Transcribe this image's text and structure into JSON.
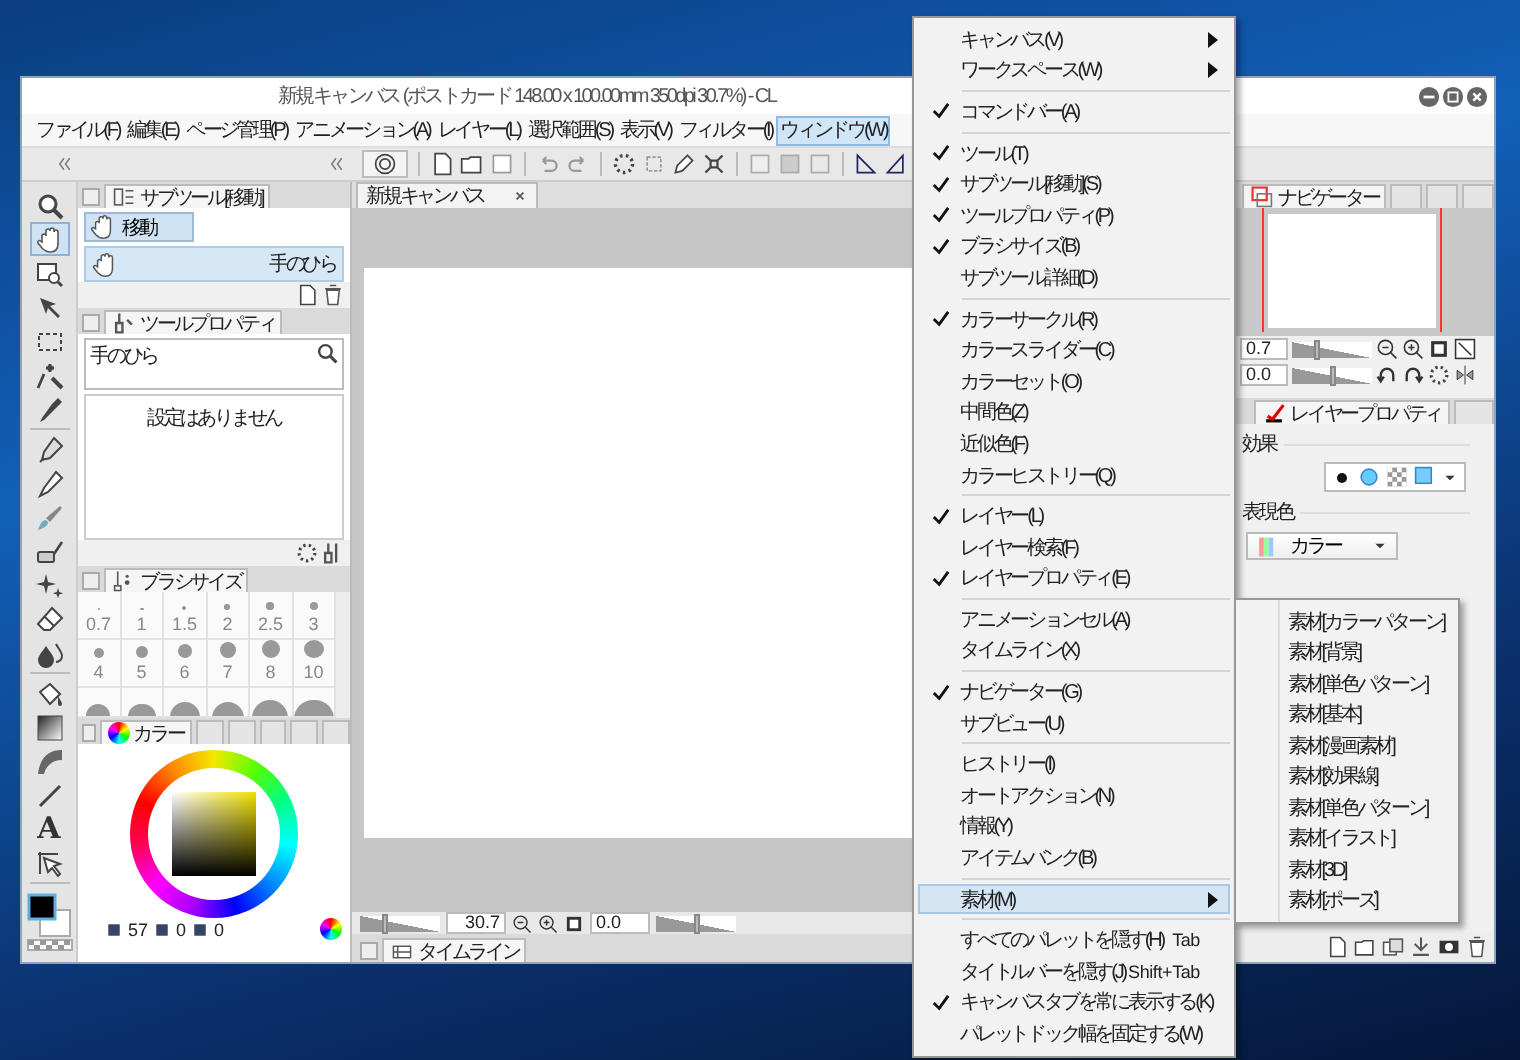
{
  "window": {
    "title": "新規キャンバス (ポストカード 148.00 x 100.00mm 350dpi 30.7%) - CL"
  },
  "menu_bar": [
    {
      "label": "ファイル(F)",
      "selected": false
    },
    {
      "label": "編集(E)",
      "selected": false
    },
    {
      "label": "ページ管理(P)",
      "selected": false
    },
    {
      "label": "アニメーション(A)",
      "selected": false
    },
    {
      "label": "レイヤー(L)",
      "selected": false
    },
    {
      "label": "選択範囲(S)",
      "selected": false
    },
    {
      "label": "表示(V)",
      "selected": false
    },
    {
      "label": "フィルター(I)",
      "selected": false
    },
    {
      "label": "ウィンドウ(W)",
      "selected": true
    }
  ],
  "tool_groups": [
    {
      "tools": [
        {
          "kind": "zoom",
          "selected": false
        },
        {
          "kind": "hand",
          "selected": true
        },
        {
          "kind": "rotate",
          "selected": false
        },
        {
          "kind": "move",
          "selected": false
        },
        {
          "kind": "marquee",
          "selected": false
        },
        {
          "kind": "wand",
          "selected": false
        },
        {
          "kind": "eyedropper",
          "selected": false
        }
      ]
    },
    {
      "tools": [
        {
          "kind": "pen",
          "selected": false
        },
        {
          "kind": "pencil",
          "selected": false
        },
        {
          "kind": "brush",
          "selected": false
        },
        {
          "kind": "airbrush",
          "selected": false
        },
        {
          "kind": "sparkle",
          "selected": false
        },
        {
          "kind": "eraser",
          "selected": false
        },
        {
          "kind": "blend",
          "selected": false
        }
      ]
    },
    {
      "tools": [
        {
          "kind": "fill",
          "selected": false
        },
        {
          "kind": "gradient",
          "selected": false
        },
        {
          "kind": "curve",
          "selected": false
        },
        {
          "kind": "line",
          "selected": false
        },
        {
          "kind": "text",
          "glyph": "A",
          "selected": false
        },
        {
          "kind": "frame",
          "selected": false
        }
      ]
    }
  ],
  "sub_tool": {
    "tab": "サブツール[移動]",
    "group": "移動",
    "items": [
      {
        "label": "手のひら",
        "selected": true
      }
    ]
  },
  "tool_property": {
    "tab": "ツールプロパティ",
    "tool_name": "手のひら",
    "message": "設定はありません"
  },
  "brush_size": {
    "tab": "ブラシサイズ",
    "sizes": [
      "0.7",
      "1",
      "1.5",
      "2",
      "2.5",
      "3",
      "4",
      "5",
      "6",
      "7",
      "8",
      "10"
    ]
  },
  "color": {
    "tab": "カラー",
    "readouts": [
      "57",
      "0",
      "0"
    ]
  },
  "canvas": {
    "tab": "新規キャンバス",
    "zoom": "30.7",
    "zoom_slider": {
      "level": 0.3
    },
    "angle": "0.0",
    "angle_slider": {
      "level": 0.5
    },
    "timeline_tab": "タイムライン"
  },
  "navigator": {
    "tab": "ナビゲーター",
    "zoom": "0.7",
    "zoom_slider": {
      "level": 0.3
    },
    "angle": "0.0",
    "angle_slider": {
      "level": 0.5
    }
  },
  "layer_property": {
    "tab": "レイヤープロパティ",
    "effect_label": "効果",
    "expression_label": "表現色",
    "expression_value": "カラー"
  },
  "window_menu": {
    "groups": [
      {
        "items": [
          {
            "label": "キャンバス(V)",
            "kind": "submenu",
            "checked": false,
            "selected": false
          },
          {
            "label": "ワークスペース(W)",
            "kind": "submenu",
            "checked": false,
            "selected": false
          }
        ]
      },
      {
        "items": [
          {
            "label": "コマンドバー(A)",
            "kind": "item",
            "checked": true,
            "selected": false
          }
        ]
      },
      {
        "items": [
          {
            "label": "ツール(T)",
            "kind": "item",
            "checked": true,
            "selected": false
          },
          {
            "label": "サブツール[移動](S)",
            "kind": "item",
            "checked": true,
            "selected": false
          },
          {
            "label": "ツールプロパティ(P)",
            "kind": "item",
            "checked": true,
            "selected": false
          },
          {
            "label": "ブラシサイズ(B)",
            "kind": "item",
            "checked": true,
            "selected": false
          },
          {
            "label": "サブツール詳細(D)",
            "kind": "item",
            "checked": false,
            "selected": false
          }
        ]
      },
      {
        "items": [
          {
            "label": "カラーサークル(R)",
            "kind": "item",
            "checked": true,
            "selected": false
          },
          {
            "label": "カラースライダー(C)",
            "kind": "item",
            "checked": false,
            "selected": false
          },
          {
            "label": "カラーセット(O)",
            "kind": "item",
            "checked": false,
            "selected": false
          },
          {
            "label": "中間色(Z)",
            "kind": "item",
            "checked": false,
            "selected": false
          },
          {
            "label": "近似色(F)",
            "kind": "item",
            "checked": false,
            "selected": false
          },
          {
            "label": "カラーヒストリー(Q)",
            "kind": "item",
            "checked": false,
            "selected": false
          }
        ]
      },
      {
        "items": [
          {
            "label": "レイヤー(L)",
            "kind": "item",
            "checked": true,
            "selected": false
          },
          {
            "label": "レイヤー検索(F)",
            "kind": "item",
            "checked": false,
            "selected": false
          },
          {
            "label": "レイヤープロパティ(E)",
            "kind": "item",
            "checked": true,
            "selected": false
          }
        ]
      },
      {
        "items": [
          {
            "label": "アニメーションセル(A)",
            "kind": "item",
            "checked": false,
            "selected": false
          },
          {
            "label": "タイムライン(X)",
            "kind": "item",
            "checked": false,
            "selected": false
          }
        ]
      },
      {
        "items": [
          {
            "label": "ナビゲーター(G)",
            "kind": "item",
            "checked": true,
            "selected": false
          },
          {
            "label": "サブビュー(U)",
            "kind": "item",
            "checked": false,
            "selected": false
          }
        ]
      },
      {
        "items": [
          {
            "label": "ヒストリー(I)",
            "kind": "item",
            "checked": false,
            "selected": false
          },
          {
            "label": "オートアクション(N)",
            "kind": "item",
            "checked": false,
            "selected": false
          },
          {
            "label": "情報(Y)",
            "kind": "item",
            "checked": false,
            "selected": false
          },
          {
            "label": "アイテムバンク(B)",
            "kind": "item",
            "checked": false,
            "selected": false
          }
        ]
      },
      {
        "items": [
          {
            "label": "素材(M)",
            "kind": "submenu",
            "checked": false,
            "selected": true,
            "submenu": [
              {
                "label": "素材[カラーパターン]"
              },
              {
                "label": "素材[背景]"
              },
              {
                "label": "素材[単色パターン]"
              },
              {
                "label": "素材[基本]"
              },
              {
                "label": "素材[漫画素材]"
              },
              {
                "label": "素材[効果線]"
              },
              {
                "label": "素材[単色パターン]"
              },
              {
                "label": "素材[イラスト]"
              },
              {
                "label": "素材[3D]"
              },
              {
                "label": "素材[ポーズ]"
              }
            ]
          }
        ]
      },
      {
        "items": [
          {
            "label": "すべてのパレットを隠す(H)",
            "kind": "item",
            "checked": false,
            "selected": false,
            "shortcut": "Tab"
          },
          {
            "label": "タイトルバーを隠す(J)",
            "kind": "item",
            "checked": false,
            "selected": false,
            "shortcut": "Shift+Tab"
          },
          {
            "label": "キャンバスタブを常に表示する(K)",
            "kind": "item",
            "checked": true,
            "selected": false
          },
          {
            "label": "パレットドック幅を固定する(W)",
            "kind": "item",
            "checked": false,
            "selected": false
          }
        ]
      }
    ]
  }
}
